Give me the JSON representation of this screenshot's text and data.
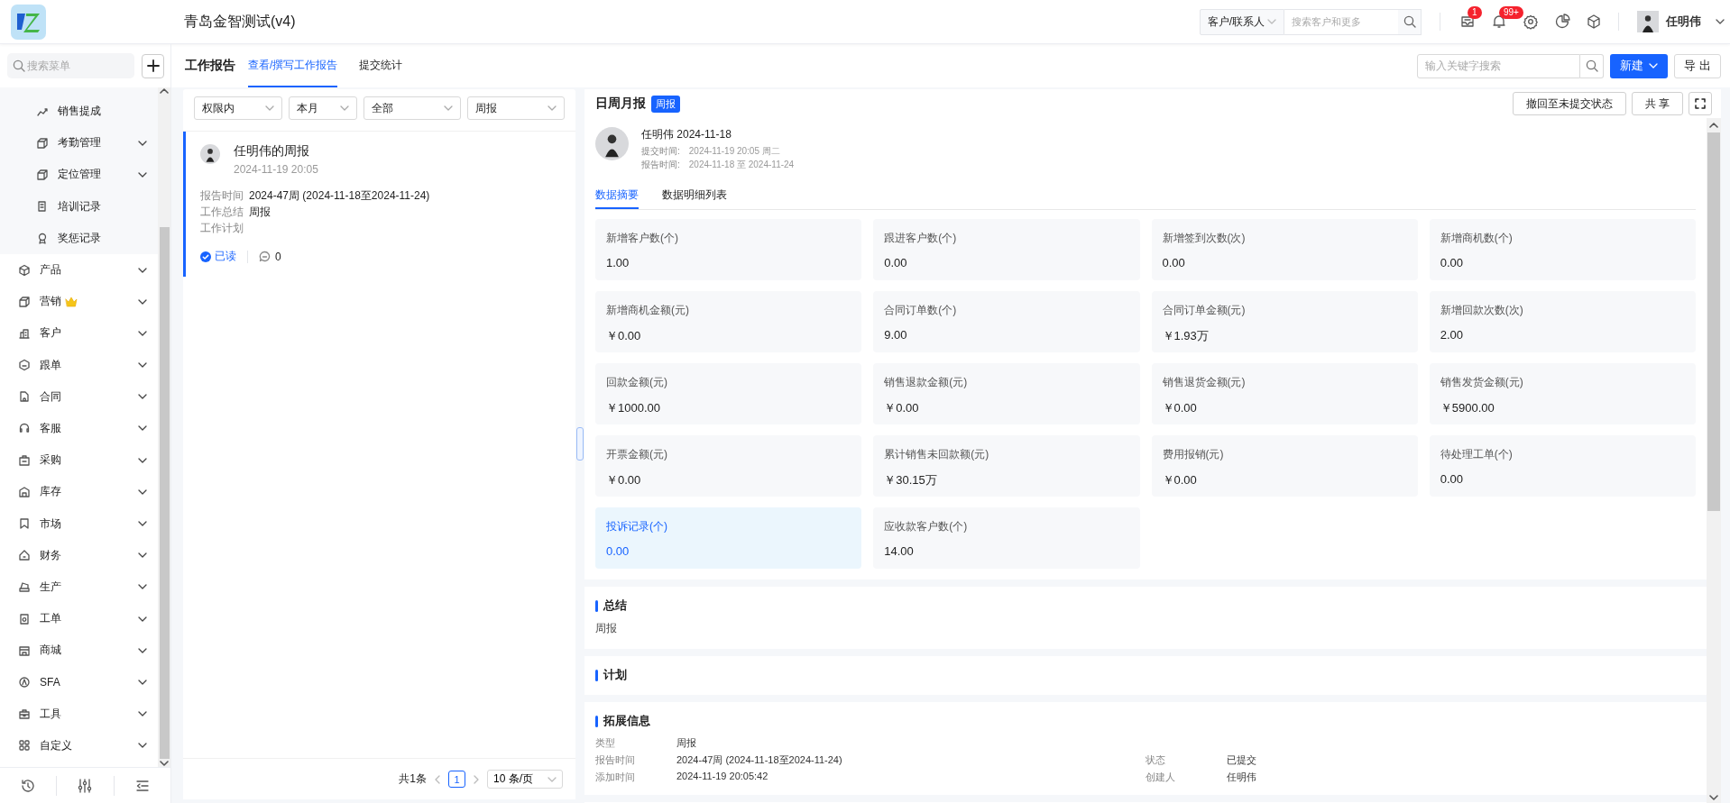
{
  "app": {
    "title": "青岛金智测试(v4)"
  },
  "topbar": {
    "search_scope": "客户/联系人",
    "search_placeholder": "搜索客户和更多",
    "badges": [
      "1",
      "99+"
    ],
    "user": "任明伟"
  },
  "sidebar": {
    "search_placeholder": "搜索菜单",
    "items": [
      {
        "label": "销售提成",
        "kind": "sub",
        "has_children": false,
        "crown": false
      },
      {
        "label": "考勤管理",
        "kind": "sub",
        "has_children": true,
        "crown": false
      },
      {
        "label": "定位管理",
        "kind": "sub",
        "has_children": true,
        "crown": false
      },
      {
        "label": "培训记录",
        "kind": "sub",
        "has_children": false,
        "crown": false
      },
      {
        "label": "奖惩记录",
        "kind": "sub",
        "has_children": false,
        "crown": false
      },
      {
        "label": "产品",
        "kind": "top",
        "has_children": true,
        "crown": false
      },
      {
        "label": "营销",
        "kind": "top",
        "has_children": true,
        "crown": true
      },
      {
        "label": "客户",
        "kind": "top",
        "has_children": true,
        "crown": false
      },
      {
        "label": "跟单",
        "kind": "top",
        "has_children": true,
        "crown": false
      },
      {
        "label": "合同",
        "kind": "top",
        "has_children": true,
        "crown": false
      },
      {
        "label": "客服",
        "kind": "top",
        "has_children": true,
        "crown": false
      },
      {
        "label": "采购",
        "kind": "top",
        "has_children": true,
        "crown": false
      },
      {
        "label": "库存",
        "kind": "top",
        "has_children": true,
        "crown": false
      },
      {
        "label": "市场",
        "kind": "top",
        "has_children": true,
        "crown": false
      },
      {
        "label": "财务",
        "kind": "top",
        "has_children": true,
        "crown": false
      },
      {
        "label": "生产",
        "kind": "top",
        "has_children": true,
        "crown": false
      },
      {
        "label": "工单",
        "kind": "top",
        "has_children": true,
        "crown": false
      },
      {
        "label": "商城",
        "kind": "top",
        "has_children": true,
        "crown": false
      },
      {
        "label": "SFA",
        "kind": "top",
        "has_children": true,
        "crown": false
      },
      {
        "label": "工具",
        "kind": "top",
        "has_children": true,
        "crown": false
      },
      {
        "label": "自定义",
        "kind": "top",
        "has_children": true,
        "crown": false
      }
    ]
  },
  "page": {
    "title": "工作报告",
    "tabs": [
      {
        "label": "查看/撰写工作报告",
        "selected": true
      },
      {
        "label": "提交统计",
        "selected": false
      }
    ],
    "search_placeholder": "输入关键字搜索",
    "new_button": "新建",
    "export_button": "导 出"
  },
  "list": {
    "filters": [
      "权限内",
      "本月",
      "全部",
      "周报"
    ],
    "reports": [
      {
        "title": "任明伟的周报",
        "time": "2024-11-19 20:05",
        "selected": true,
        "fields": [
          {
            "label": "报告时间",
            "value": "2024-47周 (2024-11-18至2024-11-24)"
          },
          {
            "label": "工作总结",
            "value": "周报"
          },
          {
            "label": "工作计划"
          }
        ],
        "read": true,
        "read_label": "已读",
        "comments": "0"
      }
    ],
    "pagination": {
      "total": "共1条",
      "page": "1",
      "page_size": "10 条/页"
    }
  },
  "detail": {
    "title": "日周月报",
    "tag": "周报",
    "actions": [
      "撤回至未提交状态",
      "共 享"
    ],
    "author_line": "任明伟 2024-11-18",
    "submit_label": "提交时间:",
    "submit_value": "2024-11-19 20:05 周二",
    "report_label": "报告时间:",
    "report_value": "2024-11-18 至 2024-11-24",
    "tabs": [
      {
        "label": "数据摘要",
        "selected": true
      },
      {
        "label": "数据明细列表",
        "selected": false
      }
    ],
    "metrics": [
      {
        "label": "新增客户数(个)",
        "value": "1.00",
        "selected": false
      },
      {
        "label": "跟进客户数(个)",
        "value": "0.00",
        "selected": false
      },
      {
        "label": "新增签到次数(次)",
        "value": "0.00",
        "selected": false
      },
      {
        "label": "新增商机数(个)",
        "value": "0.00",
        "selected": false
      },
      {
        "label": "新增商机金额(元)",
        "value": "￥0.00",
        "selected": false
      },
      {
        "label": "合同订单数(个)",
        "value": "9.00",
        "selected": false
      },
      {
        "label": "合同订单金额(元)",
        "value": "￥1.93万",
        "selected": false
      },
      {
        "label": "新增回款次数(次)",
        "value": "2.00",
        "selected": false
      },
      {
        "label": "回款金额(元)",
        "value": "￥1000.00",
        "selected": false
      },
      {
        "label": "销售退款金额(元)",
        "value": "￥0.00",
        "selected": false
      },
      {
        "label": "销售退货金额(元)",
        "value": "￥0.00",
        "selected": false
      },
      {
        "label": "销售发货金额(元)",
        "value": "￥5900.00",
        "selected": false
      },
      {
        "label": "开票金额(元)",
        "value": "￥0.00",
        "selected": false
      },
      {
        "label": "累计销售未回款额(元)",
        "value": "￥30.15万",
        "selected": false
      },
      {
        "label": "费用报销(元)",
        "value": "￥0.00",
        "selected": false
      },
      {
        "label": "待处理工单(个)",
        "value": "0.00",
        "selected": false
      },
      {
        "label": "投诉记录(个)",
        "value": "0.00",
        "selected": true
      },
      {
        "label": "应收款客户数(个)",
        "value": "14.00",
        "selected": false
      }
    ],
    "summary": {
      "title": "总结",
      "text": "周报"
    },
    "plan": {
      "title": "计划"
    },
    "extended": {
      "title": "拓展信息",
      "rows": [
        [
          {
            "label": "类型",
            "value": "周报"
          }
        ],
        [
          {
            "label": "报告时间",
            "value": "2024-47周 (2024-11-18至2024-11-24)"
          },
          {
            "label": "状态",
            "value": "已提交"
          }
        ],
        [
          {
            "label": "添加时间",
            "value": "2024-11-19 20:05:42"
          },
          {
            "label": "创建人",
            "value": "任明伟"
          }
        ]
      ]
    }
  }
}
